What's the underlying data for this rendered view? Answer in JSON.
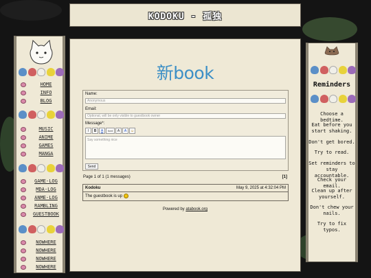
{
  "header": {
    "title": "KODOKU - 孤独"
  },
  "sidebar": {
    "groups": [
      {
        "items": [
          {
            "label": "HOME"
          },
          {
            "label": "INFO"
          },
          {
            "label": "BLOG"
          }
        ]
      },
      {
        "items": [
          {
            "label": "MUSIC"
          },
          {
            "label": "ANIME"
          },
          {
            "label": "GAMES"
          },
          {
            "label": "MANGA"
          }
        ]
      },
      {
        "items": [
          {
            "label": "GAME-LOG"
          },
          {
            "label": "MDA-LOG"
          },
          {
            "label": "ANME-LOG"
          },
          {
            "label": "RAMBLING"
          },
          {
            "label": "GUESTBOOK"
          }
        ]
      },
      {
        "items": [
          {
            "label": "NOWHERE"
          },
          {
            "label": "NOWHERE"
          },
          {
            "label": "NOWHERE"
          },
          {
            "label": "NOWHERE"
          }
        ]
      }
    ]
  },
  "guestbook": {
    "title": "新book",
    "form": {
      "name_label": "Name:",
      "name_placeholder": "Anonymous",
      "email_label": "Email:",
      "email_placeholder": "Optional, will be only visible to guestbook owner",
      "message_label": "Message*:",
      "message_placeholder": "Say something nice",
      "send_label": "Send",
      "toolbar": [
        "I",
        "B",
        "A",
        "font",
        "A",
        "A",
        "☺"
      ]
    },
    "page_info": "Page 1 of 1 (1 messages)",
    "page_number": "[1]",
    "entries": [
      {
        "author": "Kodoku",
        "date": "May 9, 2025 at 4:32:04 PM",
        "message": "The guestbook is up"
      }
    ],
    "powered_prefix": "Powered by ",
    "powered_link": "atabook.org"
  },
  "reminders": {
    "title": "Reminders",
    "items": [
      "Choose a bedtime.",
      "Eat before you start shaking.",
      "Don't get bored.",
      "Try to read.",
      "Set reminders to stay accountable.",
      "Check your email.",
      "Clean up after yourself.",
      "Don't chew your nails.",
      "Try to fix typos."
    ]
  },
  "colors": {
    "title_blue": "#3c8fc6",
    "link_pink": "#d98aaa",
    "parchment": "#efe9d6",
    "critters": [
      "#5b8fc7",
      "#d06060",
      "#f0efe8",
      "#e8d23a",
      "#9c6bb8"
    ]
  }
}
